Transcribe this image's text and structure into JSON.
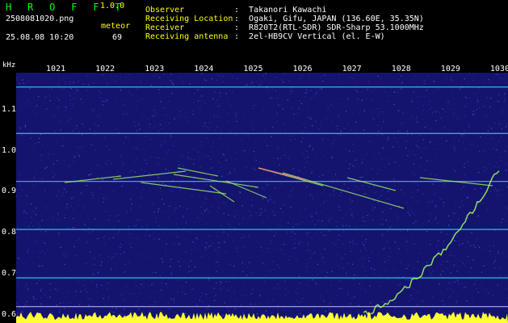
{
  "header": {
    "app_name": "H R O F F T",
    "version": "1.0.0",
    "filename": "2508081020.png",
    "meteor_label": "meteor",
    "datetime": "25.08.08 10:20",
    "meteor_count": "69",
    "fields": [
      {
        "label": "Observer",
        "value": ":  Takanori Kawachi"
      },
      {
        "label": "Receiving Location",
        "value": ":  Ogaki, Gifu, JAPAN (136.60E, 35.35N)"
      },
      {
        "label": "Receiver",
        "value": ":  R820T2(RTL-SDR) SDR-Sharp 53.1000MHz"
      },
      {
        "label": "Receiving antenna",
        "value": ":  2el-HB9CV Vertical (el. E-W)"
      }
    ]
  },
  "spectrogram": {
    "unit": "kHz",
    "time_labels": [
      "1021",
      "1022",
      "1023",
      "1024",
      "1025",
      "1026",
      "1027",
      "1028",
      "1029",
      "1030"
    ],
    "freq_labels": [
      "1.1",
      "1.0",
      "0.9",
      "0.8",
      "0.7",
      "0.6"
    ],
    "freq_values": [
      1.1,
      1.0,
      0.9,
      0.8,
      0.7,
      0.6
    ],
    "freq_range": [
      0.58,
      1.19
    ],
    "carrier_lines_khz": [
      1.155,
      1.042,
      0.925,
      0.808,
      0.69,
      0.62
    ],
    "colors": {
      "background": "#14146e",
      "carrier": "#3ad8ff",
      "baseline_noise": "#ffff33",
      "meteor": "#a8ff60"
    }
  }
}
